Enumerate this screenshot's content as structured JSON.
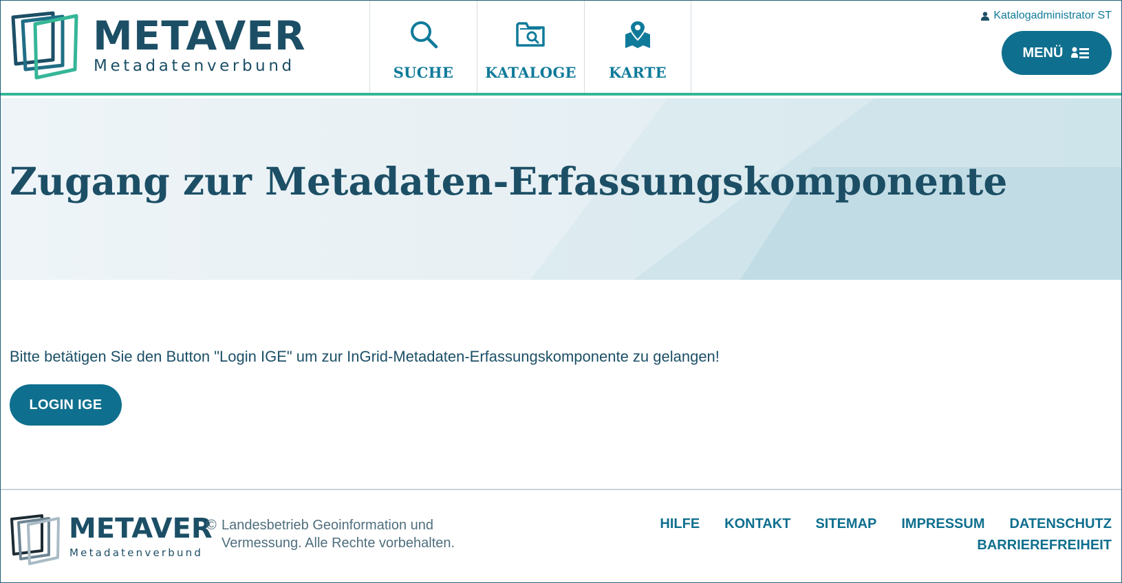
{
  "header": {
    "brand": "METAVER",
    "tagline": "Metadatenverbund",
    "nav": [
      {
        "label": "SUCHE",
        "icon": "search-icon"
      },
      {
        "label": "KATALOGE",
        "icon": "folder-search-icon"
      },
      {
        "label": "KARTE",
        "icon": "map-pin-icon"
      }
    ],
    "user": "Katalogadministrator ST",
    "menu_label": "MENÜ"
  },
  "hero": {
    "title": "Zugang zur Metadaten-Erfassungskomponente"
  },
  "main": {
    "intro": "Bitte betätigen Sie den Button \"Login IGE\" um zur InGrid-Metadaten-Erfassungskomponente zu gelangen!",
    "login_label": "LOGIN IGE"
  },
  "footer": {
    "brand": "METAVER",
    "tagline": "Metadatenverbund",
    "copyright_symbol": "©",
    "copyright": "Landesbetrieb Geoinformation und Vermessung. Alle Rechte vorbehalten.",
    "links": [
      "HILFE",
      "KONTAKT",
      "SITEMAP",
      "IMPRESSUM",
      "DATENSCHUTZ"
    ],
    "link_accessibility": "BARRIEREFREIHEIT"
  },
  "colors": {
    "primary": "#0f6f8e",
    "text": "#1c4f66",
    "accent": "#35b697"
  }
}
